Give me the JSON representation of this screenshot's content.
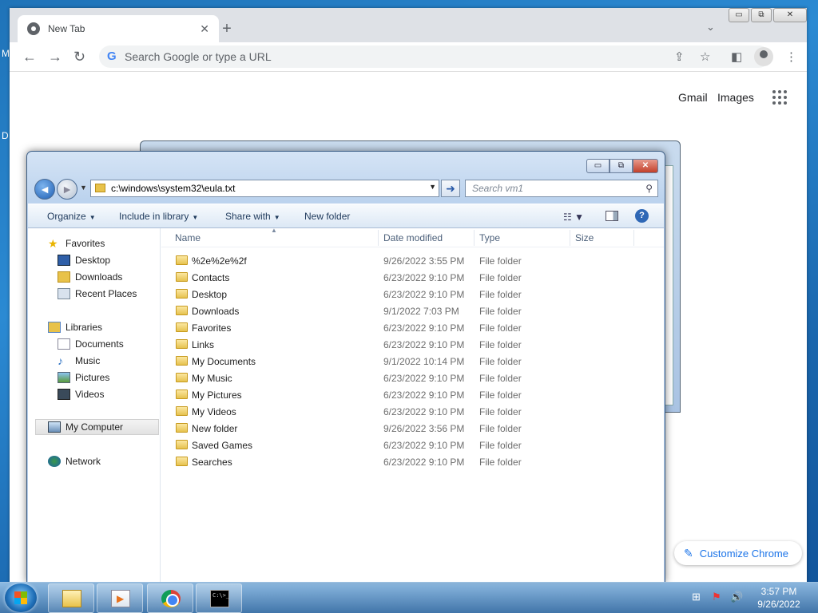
{
  "desktop": {
    "edge_letters": [
      "M",
      "D"
    ]
  },
  "chrome": {
    "tab_title": "New Tab",
    "tab_close": "✕",
    "new_tab": "+",
    "tab_search": "⌄",
    "window_buttons": [
      "▭",
      "⧉",
      "✕"
    ],
    "back": "←",
    "forward": "→",
    "reload": "↻",
    "omnibox_g": "G",
    "omnibox_placeholder": "Search Google or type a URL",
    "share": "⇪",
    "star": "☆",
    "side_panel": "◧",
    "menu": "⋮",
    "gmail": "Gmail",
    "images": "Images",
    "customize": "Customize Chrome",
    "customize_icon": "✎"
  },
  "explorer": {
    "window_buttons": [
      "▭",
      "⧉",
      "✕"
    ],
    "back": "◄",
    "forward": "►",
    "history": "▼",
    "address_value": "c:\\windows\\system32\\eula.txt",
    "address_dropdown": "▼",
    "go": "➜",
    "search_placeholder": "Search vm1",
    "search_icon": "⚲",
    "commands": {
      "organize": "Organize",
      "include": "Include in library",
      "share": "Share with",
      "new_folder": "New folder",
      "dropdown_arrow": "▼",
      "view_icon": "☷ ▼",
      "help": "?"
    },
    "nav": {
      "favorites": "Favorites",
      "desktop": "Desktop",
      "downloads": "Downloads",
      "recent": "Recent Places",
      "libraries": "Libraries",
      "documents": "Documents",
      "music": "Music",
      "pictures": "Pictures",
      "videos": "Videos",
      "computer": "My Computer",
      "network": "Network"
    },
    "columns": {
      "name": "Name",
      "date": "Date modified",
      "type": "Type",
      "size": "Size",
      "sort": "▲"
    },
    "files": [
      {
        "name": "%2e%2e%2f",
        "date": "9/26/2022 3:55 PM",
        "type": "File folder"
      },
      {
        "name": "Contacts",
        "date": "6/23/2022 9:10 PM",
        "type": "File folder"
      },
      {
        "name": "Desktop",
        "date": "6/23/2022 9:10 PM",
        "type": "File folder"
      },
      {
        "name": "Downloads",
        "date": "9/1/2022 7:03 PM",
        "type": "File folder"
      },
      {
        "name": "Favorites",
        "date": "6/23/2022 9:10 PM",
        "type": "File folder"
      },
      {
        "name": "Links",
        "date": "6/23/2022 9:10 PM",
        "type": "File folder"
      },
      {
        "name": "My Documents",
        "date": "9/1/2022 10:14 PM",
        "type": "File folder"
      },
      {
        "name": "My Music",
        "date": "6/23/2022 9:10 PM",
        "type": "File folder"
      },
      {
        "name": "My Pictures",
        "date": "6/23/2022 9:10 PM",
        "type": "File folder"
      },
      {
        "name": "My Videos",
        "date": "6/23/2022 9:10 PM",
        "type": "File folder"
      },
      {
        "name": "New folder",
        "date": "9/26/2022 3:56 PM",
        "type": "File folder"
      },
      {
        "name": "Saved Games",
        "date": "6/23/2022 9:10 PM",
        "type": "File folder"
      },
      {
        "name": "Searches",
        "date": "6/23/2022 9:10 PM",
        "type": "File folder"
      }
    ]
  },
  "taskbar": {
    "cmd_text": "C:\\>_",
    "tray_icons": [
      "⊞",
      "⚑",
      "🔊"
    ],
    "time": "3:57 PM",
    "date": "9/26/2022"
  }
}
